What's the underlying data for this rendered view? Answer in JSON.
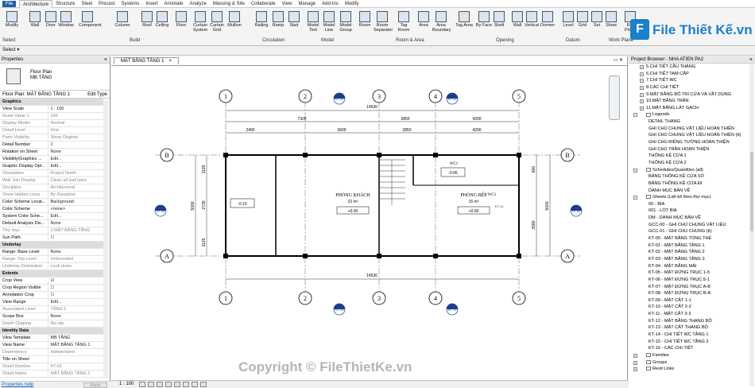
{
  "menu": {
    "file": "File",
    "tabs": [
      "Architecture",
      "Structure",
      "Steel",
      "Precast",
      "Systems",
      "Insert",
      "Annotate",
      "Analyze",
      "Massing & Site",
      "Collaborate",
      "View",
      "Manage",
      "Add-Ins",
      "Modify"
    ]
  },
  "ribbon": {
    "buttons": [
      "Modify",
      "Wall",
      "Door",
      "Window",
      "Component",
      "Column",
      "Roof",
      "Ceiling",
      "Floor",
      "Curtain System",
      "Curtain Grid",
      "Mullion",
      "Railing",
      "Ramp",
      "Stair",
      "Model Text",
      "Model Line",
      "Model Group",
      "Room",
      "Room Separator",
      "Tag Room",
      "Area",
      "Area Boundary",
      "Tag Area",
      "By Face",
      "Shaft",
      "Wall",
      "Vertical",
      "Dormer",
      "Level",
      "Grid",
      "Set",
      "Show",
      "Ref Plane"
    ],
    "groups": [
      "Select",
      "Build",
      "Circulation",
      "Model",
      "Room & Area",
      "Opening",
      "Datum",
      "Work Plane"
    ]
  },
  "logo": {
    "mark": "F",
    "text": "File Thiết Kế.vn"
  },
  "quickbar": {
    "select": "Select ▾"
  },
  "properties": {
    "title": "Properties",
    "type_line1": "Floor Plan",
    "type_line2": "MB TẦNG",
    "selector": "Floor Plan: MẶT BẰNG TẦNG 1",
    "edit_type": "Edit Type",
    "rows": [
      {
        "k": "Graphics",
        "sec": true
      },
      {
        "k": "View Scale",
        "v": "1 : 100"
      },
      {
        "k": "Scale Value    1:",
        "v": "100",
        "dis": true
      },
      {
        "k": "Display Model",
        "v": "Normal",
        "dis": true
      },
      {
        "k": "Detail Level",
        "v": "Fine",
        "dis": true
      },
      {
        "k": "Parts Visibility",
        "v": "Show Original",
        "dis": true
      },
      {
        "k": "Detail Number",
        "v": "1"
      },
      {
        "k": "Rotation on Sheet",
        "v": "None"
      },
      {
        "k": "Visibility/Graphics ...",
        "v": "Edit..."
      },
      {
        "k": "Graphic Display Opt...",
        "v": "Edit..."
      },
      {
        "k": "Orientation",
        "v": "Project North",
        "dis": true
      },
      {
        "k": "Wall Join Display",
        "v": "Clean all wall joins",
        "dis": true
      },
      {
        "k": "Discipline",
        "v": "Architectural",
        "dis": true
      },
      {
        "k": "Show Hidden Lines",
        "v": "By Discipline",
        "dis": true
      },
      {
        "k": "Color Scheme Locat...",
        "v": "Background"
      },
      {
        "k": "Color Scheme",
        "v": "<none>"
      },
      {
        "k": "System Color Sche...",
        "v": "Edit..."
      },
      {
        "k": "Default Analysis Dis...",
        "v": "None"
      },
      {
        "k": "Thư mục",
        "v": "2.MẶT BẰNG TẦNG",
        "dis": true
      },
      {
        "k": "Sun Path",
        "v": "☐"
      },
      {
        "k": "Underlay",
        "sec": true
      },
      {
        "k": "Range: Base Level",
        "v": "None"
      },
      {
        "k": "Range: Top Level",
        "v": "Unbounded",
        "dis": true
      },
      {
        "k": "Underlay Orientation",
        "v": "Look down",
        "dis": true
      },
      {
        "k": "Extents",
        "sec": true
      },
      {
        "k": "Crop View",
        "v": "☑"
      },
      {
        "k": "Crop Region Visible",
        "v": "☐"
      },
      {
        "k": "Annotation Crop",
        "v": "☐"
      },
      {
        "k": "View Range",
        "v": "Edit..."
      },
      {
        "k": "Associated Level",
        "v": "TẦNG 1",
        "dis": true
      },
      {
        "k": "Scope Box",
        "v": "None"
      },
      {
        "k": "Depth Clipping",
        "v": "No clip",
        "dis": true
      },
      {
        "k": "Identity Data",
        "sec": true
      },
      {
        "k": "View Template",
        "v": "MB TẦNG"
      },
      {
        "k": "View Name",
        "v": "MẶT BẰNG TẦNG 1"
      },
      {
        "k": "Dependency",
        "v": "Independent",
        "dis": true
      },
      {
        "k": "Title on Sheet",
        "v": ""
      },
      {
        "k": "Sheet Number",
        "v": "KT-01",
        "dis": true
      },
      {
        "k": "Sheet Name",
        "v": "MẶT BẰNG TẦNG 1",
        "dis": true
      }
    ],
    "help": "Properties help",
    "apply": "Apply"
  },
  "view": {
    "tab": "MẶT BẰNG TẦNG 1",
    "scale": "1 : 100",
    "grid_top": [
      "1",
      "2",
      "3",
      "4",
      "5"
    ],
    "grid_side": [
      "B",
      "A"
    ],
    "dims_overall": "14530",
    "dims_top": [
      "7300",
      "2850",
      "4200"
    ],
    "dims_sub": [
      "2400",
      "3600",
      "2850",
      "4200"
    ],
    "dims_side_left": [
      "1135",
      "2730",
      "1135"
    ],
    "dims_side_left_total": "5000",
    "dims_side_right": [
      "800",
      "3580"
    ],
    "dims_side_right_total": "5000",
    "rooms": [
      {
        "name": "PHÒNG KHÁCH",
        "area": "22 m²",
        "level": "+0.00"
      },
      {
        "name": "PHÒNG BẾP",
        "area": "15 m²",
        "level": "+0.00"
      }
    ],
    "level_tags": [
      "-0.10",
      "-0.05"
    ],
    "wc_tags": [
      "WC1",
      "WC1"
    ],
    "section_tags": [
      "KT-10",
      "KT-11",
      "KT-08",
      "KT-09",
      "KT-10",
      "KT-11"
    ],
    "callout": "KT-14"
  },
  "browser": {
    "title": "Project Browser - NHA ATIEN PA2",
    "items": [
      {
        "t": "5.CHI TIẾT CẦU THANG",
        "lvl": "l1"
      },
      {
        "t": "6.CHI TIẾT TAM CẤP",
        "lvl": "l1"
      },
      {
        "t": "7.CHI TIẾT WC",
        "lvl": "l1"
      },
      {
        "t": "8.CÁC CHI TIẾT",
        "lvl": "l1"
      },
      {
        "t": "9.MẶT BẰNG BỐ TRÍ CỬA VÀ VẬT DỤNG",
        "lvl": "l1"
      },
      {
        "t": "10.MẶT BẰNG TRẦN",
        "lvl": "l1"
      },
      {
        "t": "11.MẶT BẰNG LÁT GẠCH",
        "lvl": "l1"
      },
      {
        "t": "Legends",
        "lvl": "grp"
      },
      {
        "t": "DETAIL THANG",
        "lvl": "leaf"
      },
      {
        "t": "GHI CHÚ CHUNG VẬT LIỆU HOÀN THIỆN",
        "lvl": "leaf"
      },
      {
        "t": "GHI CHÚ CHUNG VẬT LIỆU HOÀN THIỆN (tt)",
        "lvl": "leaf"
      },
      {
        "t": "GHI CHÚ RIÊNG TƯỜNG HOÀN THIỆN",
        "lvl": "leaf"
      },
      {
        "t": "GHI CHÚ TRẦN HOÀN THIỆN",
        "lvl": "leaf"
      },
      {
        "t": "THỐNG KÊ CỬA 1",
        "lvl": "leaf"
      },
      {
        "t": "THỐNG KÊ CỬA 2",
        "lvl": "leaf"
      },
      {
        "t": "Schedules/Quantities (all)",
        "lvl": "grp"
      },
      {
        "t": "BẢNG THỐNG KÊ CỬA SỔ",
        "lvl": "leaf"
      },
      {
        "t": "BẢNG THỐNG KÊ CỬA ĐI",
        "lvl": "leaf"
      },
      {
        "t": "DANH MỤC BẢN VẼ",
        "lvl": "leaf"
      },
      {
        "t": "Sheets (Liệt kê theo thư mục)",
        "lvl": "grp"
      },
      {
        "t": "00 - BÌA",
        "lvl": "leaf"
      },
      {
        "t": "001 - LÓT BÌA",
        "lvl": "leaf"
      },
      {
        "t": "DM - DANH MỤC BẢN VẼ",
        "lvl": "leaf"
      },
      {
        "t": "GCC-00 - GHI CHÚ CHUNG VẬT LIỆU",
        "lvl": "leaf"
      },
      {
        "t": "GCC-01 - GHI CHÚ CHUNG (tt)",
        "lvl": "leaf"
      },
      {
        "t": "KT-00 - MẶT BẰNG TỔNG THỂ",
        "lvl": "leaf"
      },
      {
        "t": "KT-01 - MẶT BẰNG TẦNG 1",
        "lvl": "leaf"
      },
      {
        "t": "KT-02 - MẶT BẰNG TẦNG 2",
        "lvl": "leaf"
      },
      {
        "t": "KT-03 - MẶT BẰNG TẦNG 3",
        "lvl": "leaf"
      },
      {
        "t": "KT-04 - MẶT BẰNG MÁI",
        "lvl": "leaf"
      },
      {
        "t": "KT-05 - MẶT ĐỨNG TRỤC 1-5",
        "lvl": "leaf"
      },
      {
        "t": "KT-06 - MẶT ĐỨNG TRỤC 5-1",
        "lvl": "leaf"
      },
      {
        "t": "KT-07 - MẶT ĐỨNG TRỤC A-B",
        "lvl": "leaf"
      },
      {
        "t": "KT-08 - MẶT ĐỨNG TRỤC B-A",
        "lvl": "leaf"
      },
      {
        "t": "KT-09 - MẶT CẮT 1-1",
        "lvl": "leaf"
      },
      {
        "t": "KT-10 - MẶT CẮT 2-2",
        "lvl": "leaf"
      },
      {
        "t": "KT-11 - MẶT CẮT 3-3",
        "lvl": "leaf"
      },
      {
        "t": "KT-12 - MẶT BẰNG THANG BỘ",
        "lvl": "leaf"
      },
      {
        "t": "KT-13 - MẶT CẮT THANG BỘ",
        "lvl": "leaf"
      },
      {
        "t": "KT-14 - CHI TIẾT WC TẦNG 1",
        "lvl": "leaf"
      },
      {
        "t": "KT-15 - CHI TIẾT WC TẦNG 2",
        "lvl": "leaf"
      },
      {
        "t": "KT-16 - CÁC CHI TIẾT",
        "lvl": "leaf"
      },
      {
        "t": "Families",
        "lvl": "grp"
      },
      {
        "t": "Groups",
        "lvl": "grp"
      },
      {
        "t": "Revit Links",
        "lvl": "grp"
      }
    ]
  },
  "watermark": "Copyright © FileThietKe.vn"
}
